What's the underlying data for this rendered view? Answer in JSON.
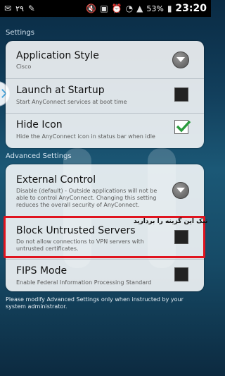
{
  "status_bar": {
    "notification_count": "٢٩",
    "battery_percent": "53%",
    "time": "23:20",
    "icons": [
      "notification-icon",
      "edit-icon",
      "mute-icon",
      "nfc-icon",
      "alarm-icon",
      "wifi-icon",
      "signal-icon",
      "battery-icon"
    ]
  },
  "settings": {
    "title": "Settings",
    "items": [
      {
        "title": "Application Style",
        "subtitle": "Cisco",
        "control": "dropdown"
      },
      {
        "title": "Launch at Startup",
        "subtitle": "Start AnyConnect services at boot time",
        "control": "checkbox",
        "checked": false
      },
      {
        "title": "Hide Icon",
        "subtitle": "Hide the AnyConnect icon in status bar when idle",
        "control": "checkbox",
        "checked": true
      }
    ]
  },
  "advanced": {
    "title": "Advanced Settings",
    "items": [
      {
        "title": "External Control",
        "subtitle_lines": [
          "Disable (default) - Outside applications will not be",
          "able to control AnyConnect. Changing this setting",
          "reduces the overall security of AnyConnect."
        ],
        "control": "dropdown"
      },
      {
        "title": "Block Untrusted Servers",
        "subtitle_lines": [
          "Do not allow connections to VPN servers with",
          "untrusted certificates."
        ],
        "control": "checkbox",
        "checked": false
      },
      {
        "title": "FIPS Mode",
        "subtitle": "Enable Federal Information Processing Standard",
        "control": "checkbox",
        "checked": false
      }
    ],
    "annotation": "تیک این گزینه را بردارید",
    "footer_note": "Please modify Advanced Settings only when instructed by your system administrator."
  },
  "colors": {
    "highlight_border": "#e0141f",
    "check_mark": "#2a9b3c"
  }
}
